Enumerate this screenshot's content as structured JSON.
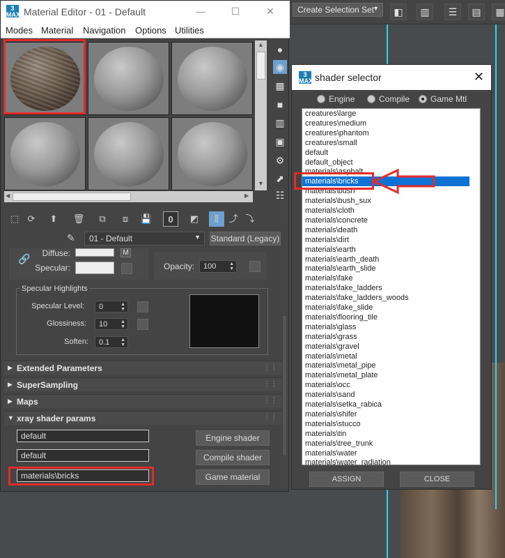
{
  "max_toolbar": {
    "selection_set_label": "Create Selection Set"
  },
  "material_editor": {
    "title": "Material Editor - 01 - Default",
    "app_badge": "3\nMAX",
    "menu": [
      "Modes",
      "Material",
      "Navigation",
      "Options",
      "Utilities"
    ],
    "material_name": "01 - Default",
    "material_type": "Standard (Legacy)",
    "toolbar_zero": "0",
    "basic": {
      "diffuse_label": "Diffuse:",
      "diffuse_map": "M",
      "specular_label": "Specular:",
      "opacity_label": "Opacity:",
      "opacity_value": "100"
    },
    "specular_highlights": {
      "group_label": "Specular Highlights",
      "level_label": "Specular Level:",
      "level_value": "0",
      "gloss_label": "Glossiness:",
      "gloss_value": "10",
      "soften_label": "Soften:",
      "soften_value": "0.1"
    },
    "rollouts": [
      "Extended Parameters",
      "SuperSampling",
      "Maps",
      "xray shader params"
    ],
    "xray": {
      "engine_value": "default",
      "compile_value": "default",
      "game_value": "materials\\bricks",
      "engine_button": "Engine shader",
      "compile_button": "Compile shader",
      "game_button": "Game material"
    }
  },
  "shader_selector": {
    "title": "shader selector",
    "app_badge": "3\nMAX",
    "radios": [
      "Engine",
      "Compile",
      "Game Mtl"
    ],
    "selected_radio": "Game Mtl",
    "items": [
      "creatures\\large",
      "creatures\\medium",
      "creatures\\phantom",
      "creatures\\small",
      "default",
      "default_object",
      "materials\\asphalt",
      "materials\\bricks",
      "materials\\bush",
      "materials\\bush_sux",
      "materials\\cloth",
      "materials\\concrete",
      "materials\\death",
      "materials\\dirt",
      "materials\\earth",
      "materials\\earth_death",
      "materials\\earth_slide",
      "materials\\fake",
      "materials\\fake_ladders",
      "materials\\fake_ladders_woods",
      "materials\\fake_slide",
      "materials\\flooring_tile",
      "materials\\glass",
      "materials\\grass",
      "materials\\gravel",
      "materials\\metal",
      "materials\\metal_pipe",
      "materials\\metal_plate",
      "materials\\occ",
      "materials\\sand",
      "materials\\setka_rabica",
      "materials\\shifer",
      "materials\\stucco",
      "materials\\tin",
      "materials\\tree_trunk",
      "materials\\water",
      "materials\\water_radiation"
    ],
    "selected_item": "materials\\bricks",
    "assign_label": "ASSIGN",
    "close_label": "CLOSE"
  },
  "colors": {
    "selection": "#0e72d4",
    "highlight": "#e52b2b",
    "viewport_line": "#2fd3f0"
  }
}
